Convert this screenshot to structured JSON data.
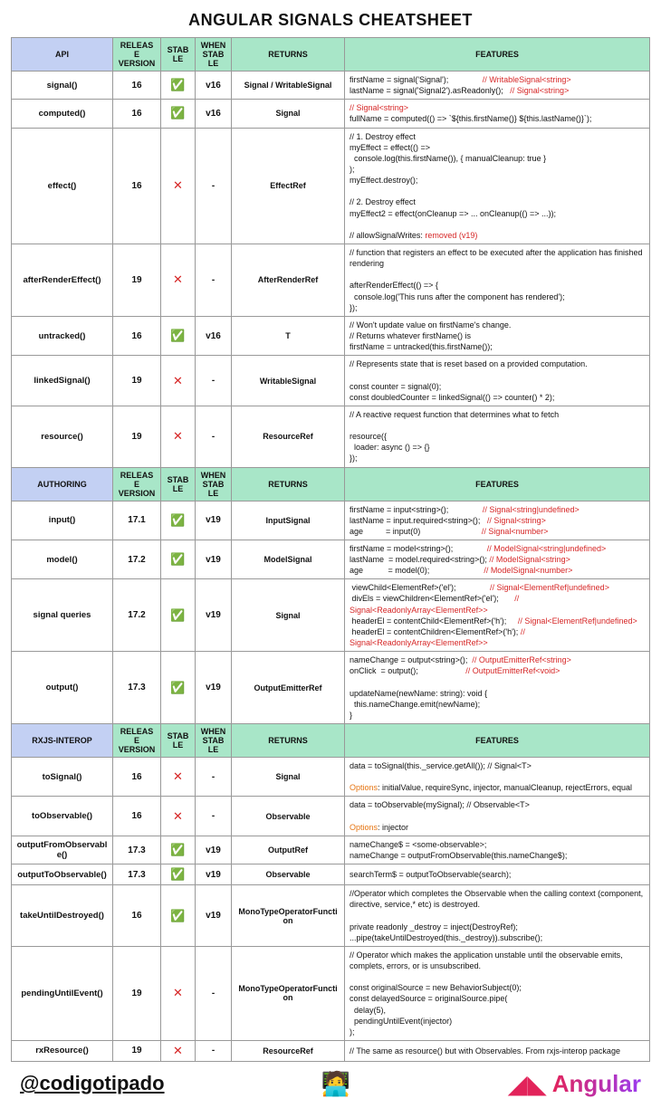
{
  "title": "ANGULAR SIGNALS CHEATSHEET",
  "icons": {
    "check": "✅",
    "cross": "✕"
  },
  "headers": {
    "release": "RELEASE VERSION",
    "stable": "STABLE",
    "when": "WHEN STABLE",
    "returns": "RETURNS",
    "features": "FEATURES"
  },
  "sections": [
    {
      "name": "API",
      "rows": [
        {
          "api": "signal()",
          "release": "16",
          "stable": true,
          "when": "v16",
          "returns": "Signal / WritableSignal",
          "features": [
            {
              "t": "firstName = signal('Signal');               "
            },
            {
              "t": "// WritableSignal<string>",
              "cls": "red"
            },
            {
              "t": "\nlastName = signal('Signal2').asReadonly();   "
            },
            {
              "t": "// Signal<string>",
              "cls": "red"
            }
          ]
        },
        {
          "api": "computed()",
          "release": "16",
          "stable": true,
          "when": "v16",
          "returns": "Signal",
          "features": [
            {
              "t": "// Signal<string>\n",
              "cls": "red"
            },
            {
              "t": "fullName = computed(() => `${this.firstName()} ${this.lastName()}`);"
            }
          ]
        },
        {
          "api": "effect()",
          "release": "16",
          "stable": false,
          "when": "-",
          "returns": "EffectRef",
          "features": [
            {
              "t": "// 1. Destroy effect\nmyEffect = effect(() =>\n  console.log(this.firstName()), { manualCleanup: true }\n);\nmyEffect.destroy();\n\n// 2. Destroy effect\nmyEffect2 = effect(onCleanup => ... onCleanup(() => ...));\n\n// allowSignalWrites: "
            },
            {
              "t": "removed (v19)",
              "cls": "red"
            }
          ]
        },
        {
          "api": "afterRenderEffect()",
          "release": "19",
          "stable": false,
          "when": "-",
          "returns": "AfterRenderRef",
          "features": [
            {
              "t": "// function that registers an effect to be executed after the application has finished rendering\n\nafterRenderEffect(() => {\n  console.log('This runs after the component has rendered');\n});"
            }
          ]
        },
        {
          "api": "untracked()",
          "release": "16",
          "stable": true,
          "when": "v16",
          "returns": "T",
          "features": [
            {
              "t": "// Won't update value on firstName's change.\n// Returns whatever firstName() is\nfirstName = untracked(this.firstName());"
            }
          ]
        },
        {
          "api": "linkedSignal()",
          "release": "19",
          "stable": false,
          "when": "-",
          "returns": "WritableSignal",
          "features": [
            {
              "t": "// Represents state that is reset based on a provided computation.\n\nconst counter = signal(0);\nconst doubledCounter = linkedSignal(() => counter() * 2);"
            }
          ]
        },
        {
          "api": "resource()",
          "release": "19",
          "stable": false,
          "when": "-",
          "returns": "ResourceRef",
          "features": [
            {
              "t": "// A reactive request function that determines what to fetch\n\nresource({\n  loader: async () => {}\n});"
            }
          ]
        }
      ]
    },
    {
      "name": "AUTHORING",
      "rows": [
        {
          "api": "input()",
          "release": "17.1",
          "stable": true,
          "when": "v19",
          "returns": "InputSignal",
          "features": [
            {
              "t": "firstName = input<string>();               "
            },
            {
              "t": "// Signal<string|undefined>",
              "cls": "red"
            },
            {
              "t": "\nlastName = input.required<string>();   "
            },
            {
              "t": "// Signal<string>",
              "cls": "red"
            },
            {
              "t": "\nage          = input(0)                           "
            },
            {
              "t": "// Signal<number>",
              "cls": "red"
            }
          ]
        },
        {
          "api": "model()",
          "release": "17.2",
          "stable": true,
          "when": "v19",
          "returns": "ModelSignal",
          "features": [
            {
              "t": "firstName = model<string>();               "
            },
            {
              "t": "// ModelSignal<string|undefined>",
              "cls": "red"
            },
            {
              "t": "\nlastName  = model.required<string>(); "
            },
            {
              "t": "// ModelSignal<string>",
              "cls": "red"
            },
            {
              "t": "\nage           = model(0);                        "
            },
            {
              "t": "// ModelSignal<number>",
              "cls": "red"
            }
          ]
        },
        {
          "api": "signal queries",
          "release": "17.2",
          "stable": true,
          "when": "v19",
          "returns": "Signal",
          "features": [
            {
              "t": " viewChild<ElementRef>('el');               "
            },
            {
              "t": "// Signal<ElementRef|undefined>",
              "cls": "red"
            },
            {
              "t": "\n divEls = viewChildren<ElementRef>('el');       "
            },
            {
              "t": "// Signal<ReadonlyArray<ElementRef>>",
              "cls": "red"
            },
            {
              "t": "\n headerEl = contentChild<ElementRef>('h');     "
            },
            {
              "t": "// Signal<ElementRef|undefined>",
              "cls": "red"
            },
            {
              "t": "\n headerEl = contentChildren<ElementRef>('h'); "
            },
            {
              "t": "// Signal<ReadonlyArray<ElementRef>>",
              "cls": "red"
            }
          ]
        },
        {
          "api": "output()",
          "release": "17.3",
          "stable": true,
          "when": "v19",
          "returns": "OutputEmitterRef",
          "features": [
            {
              "t": "nameChange = output<string>();  "
            },
            {
              "t": "// OutputEmitterRef<string>",
              "cls": "red"
            },
            {
              "t": "\nonClick  = output();                     "
            },
            {
              "t": "// OutputEmitterRef<void>",
              "cls": "red"
            },
            {
              "t": "\n\nupdateName(newName: string): void {\n  this.nameChange.emit(newName);\n}"
            }
          ]
        }
      ]
    },
    {
      "name": "RXJS-INTEROP",
      "rows": [
        {
          "api": "toSignal()",
          "release": "16",
          "stable": false,
          "when": "-",
          "returns": "Signal",
          "features": [
            {
              "t": "data = toSignal(this._service.getAll()); // Signal<T>\n\n"
            },
            {
              "t": "Options",
              "cls": "orange"
            },
            {
              "t": ": initialValue, requireSync, injector, manualCleanup, rejectErrors, equal"
            }
          ]
        },
        {
          "api": "toObservable()",
          "release": "16",
          "stable": false,
          "when": "-",
          "returns": "Observable",
          "features": [
            {
              "t": "data = toObservable(mySignal); // Observable<T>\n\n"
            },
            {
              "t": "Options",
              "cls": "orange"
            },
            {
              "t": ": injector"
            }
          ]
        },
        {
          "api": "outputFromObservable()",
          "release": "17.3",
          "stable": true,
          "when": "v19",
          "returns": "OutputRef",
          "features": [
            {
              "t": "nameChange$ = <some-observable>;\nnameChange = outputFromObservable(this.nameChange$);"
            }
          ]
        },
        {
          "api": "outputToObservable()",
          "release": "17.3",
          "stable": true,
          "when": "v19",
          "returns": "Observable",
          "features": [
            {
              "t": "searchTerm$ = outputToObservable(search);"
            }
          ]
        },
        {
          "api": "takeUntilDestroyed()",
          "release": "16",
          "stable": true,
          "when": "v19",
          "returns": "MonoTypeOperatorFunction",
          "features": [
            {
              "t": "//Operator which completes the Observable when the calling context (component, directive, service,* etc) is destroyed.\n\nprivate readonly _destroy = inject(DestroyRef);\n...pipe(takeUntilDestroyed(this._destroy)).subscribe();"
            }
          ]
        },
        {
          "api": "pendingUntilEvent()",
          "release": "19",
          "stable": false,
          "when": "-",
          "returns": "MonoTypeOperatorFunction",
          "features": [
            {
              "t": "// Operator which makes the application unstable until the observable emits, complets, errors, or is unsubscribed.\n\nconst originalSource = new BehaviorSubject(0);\nconst delayedSource = originalSource.pipe(\n  delay(5),\n  pendingUntilEvent(injector)\n);"
            }
          ]
        },
        {
          "api": "rxResource()",
          "release": "19",
          "stable": false,
          "when": "-",
          "returns": "ResourceRef",
          "features": [
            {
              "t": "// The same as resource() but with Observables. From rxjs-interop package"
            }
          ]
        }
      ]
    }
  ],
  "footer": {
    "handle": "@codigotipado",
    "angular": "Angular"
  }
}
